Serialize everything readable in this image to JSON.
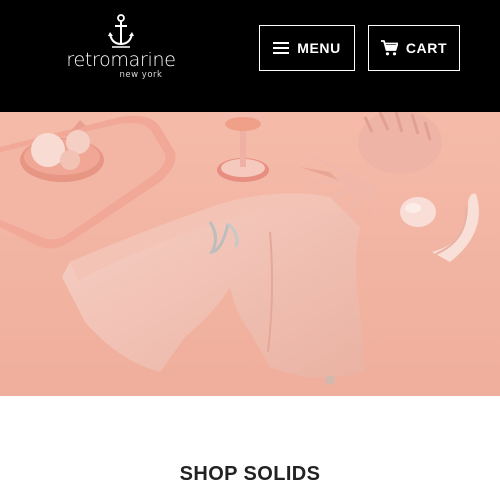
{
  "header": {
    "logo": {
      "brand": "retromarine",
      "tagline": "new york",
      "icon": "anchor-icon"
    },
    "menu_button": {
      "label": "MENU",
      "icon": "hamburger-icon"
    },
    "cart_button": {
      "label": "CART",
      "icon": "shopping-cart-icon"
    }
  },
  "hero": {
    "image": "pink-swim-shorts-still-life"
  },
  "section": {
    "title": "SHOP SOLIDS"
  },
  "colors": {
    "header_bg": "#000000",
    "hero_bg": "#f3b7a6",
    "title_text": "#222222"
  }
}
